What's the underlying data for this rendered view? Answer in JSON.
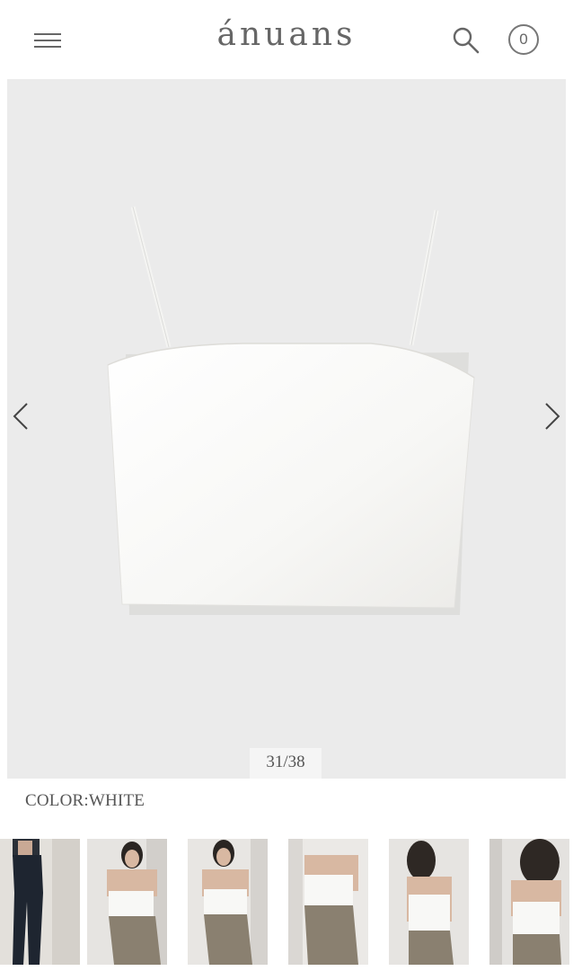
{
  "header": {
    "brand": "ánuans",
    "cart_count": "0",
    "menu_icon": "hamburger-menu-icon",
    "search_icon": "search-icon"
  },
  "gallery": {
    "counter": "31/38",
    "prev_icon": "chevron-left-icon",
    "next_icon": "chevron-right-icon",
    "image": "white camisole bandeau top on light gray background"
  },
  "product": {
    "color_label": "COLOR:WHITE"
  },
  "thumbnails": [
    {
      "subject": "model in navy camisole jumpsuit"
    },
    {
      "subject": "model in white bandeau top and khaki skirt"
    },
    {
      "subject": "model in white bandeau top and khaki skirt"
    },
    {
      "subject": "model in white bandeau top and khaki skirt"
    },
    {
      "subject": "model back view in white camisole"
    },
    {
      "subject": "model back view in white camisole"
    }
  ],
  "colors": {
    "gallery_bg": "#ebebeb",
    "text": "#555555"
  }
}
